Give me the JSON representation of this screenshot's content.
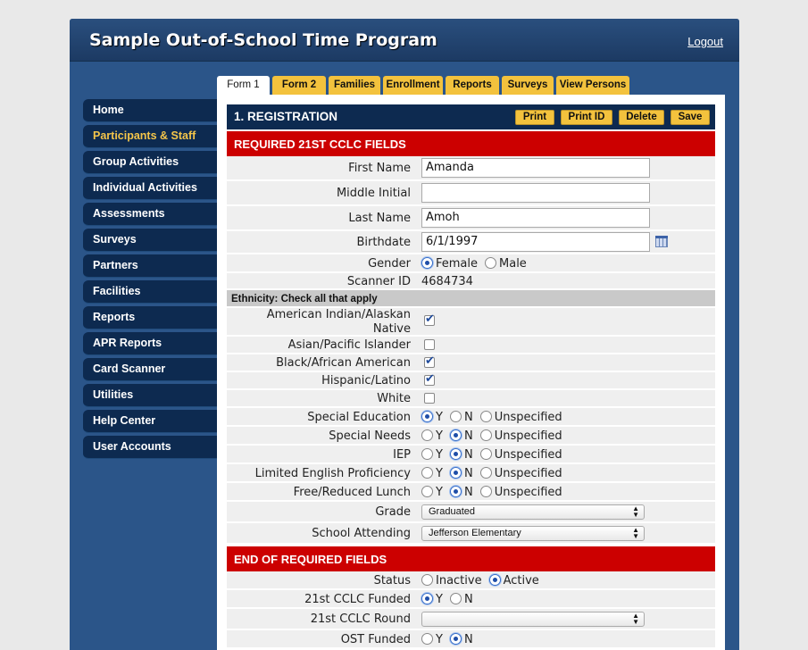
{
  "app": {
    "title": "Sample Out-of-School Time Program",
    "logout": "Logout"
  },
  "sidebar": {
    "items": [
      {
        "label": "Home",
        "active": false
      },
      {
        "label": "Participants & Staff",
        "active": true
      },
      {
        "label": "Group Activities",
        "active": false
      },
      {
        "label": "Individual Activities",
        "active": false
      },
      {
        "label": "Assessments",
        "active": false
      },
      {
        "label": "Surveys",
        "active": false
      },
      {
        "label": "Partners",
        "active": false
      },
      {
        "label": "Facilities",
        "active": false
      },
      {
        "label": "Reports",
        "active": false
      },
      {
        "label": "APR Reports",
        "active": false
      },
      {
        "label": "Card Scanner",
        "active": false
      },
      {
        "label": "Utilities",
        "active": false
      },
      {
        "label": "Help Center",
        "active": false
      },
      {
        "label": "User Accounts",
        "active": false
      }
    ]
  },
  "tabs": [
    {
      "label": "Form 1",
      "active": true
    },
    {
      "label": "Form 2",
      "active": false
    },
    {
      "label": "Families",
      "active": false
    },
    {
      "label": "Enrollment",
      "active": false
    },
    {
      "label": "Reports",
      "active": false
    },
    {
      "label": "Surveys",
      "active": false
    },
    {
      "label": "View Persons",
      "active": false
    }
  ],
  "form": {
    "section_title": "1. REGISTRATION",
    "buttons": {
      "print": "Print",
      "print_id": "Print ID",
      "delete": "Delete",
      "save": "Save"
    },
    "required_header": "REQUIRED 21ST CCLC FIELDS",
    "end_header": "END OF REQUIRED FIELDS",
    "first_name": {
      "label": "First Name",
      "value": "Amanda"
    },
    "middle_initial": {
      "label": "Middle Initial",
      "value": ""
    },
    "last_name": {
      "label": "Last Name",
      "value": "Amoh"
    },
    "birthdate": {
      "label": "Birthdate",
      "value": "6/1/1997"
    },
    "gender": {
      "label": "Gender",
      "options": [
        "Female",
        "Male"
      ],
      "selected": "Female"
    },
    "scanner_id": {
      "label": "Scanner ID",
      "value": "4684734"
    },
    "ethnicity": {
      "header": "Ethnicity: Check all that apply",
      "items": [
        {
          "label_line1": "American Indian/Alaskan",
          "label_line2": "Native",
          "checked": true
        },
        {
          "label": "Asian/Pacific Islander",
          "checked": false
        },
        {
          "label": "Black/African American",
          "checked": true
        },
        {
          "label": "Hispanic/Latino",
          "checked": true
        },
        {
          "label": "White",
          "checked": false
        }
      ]
    },
    "ynu_options": [
      "Y",
      "N",
      "Unspecified"
    ],
    "ynu_rows": [
      {
        "label": "Special Education",
        "selected": "Y"
      },
      {
        "label": "Special Needs",
        "selected": "N"
      },
      {
        "label": "IEP",
        "selected": "N"
      },
      {
        "label": "Limited English Proficiency",
        "selected": "N"
      },
      {
        "label": "Free/Reduced Lunch",
        "selected": "N"
      }
    ],
    "grade": {
      "label": "Grade",
      "value": "Graduated"
    },
    "school": {
      "label": "School Attending",
      "value": "Jefferson Elementary"
    },
    "status": {
      "label": "Status",
      "options": [
        "Inactive",
        "Active"
      ],
      "selected": "Active"
    },
    "cclc_funded": {
      "label": "21st CCLC Funded",
      "options": [
        "Y",
        "N"
      ],
      "selected": "Y"
    },
    "cclc_round": {
      "label": "21st CCLC Round",
      "value": ""
    },
    "ost_funded": {
      "label": "OST Funded",
      "options": [
        "Y",
        "N"
      ],
      "selected": "N"
    }
  }
}
